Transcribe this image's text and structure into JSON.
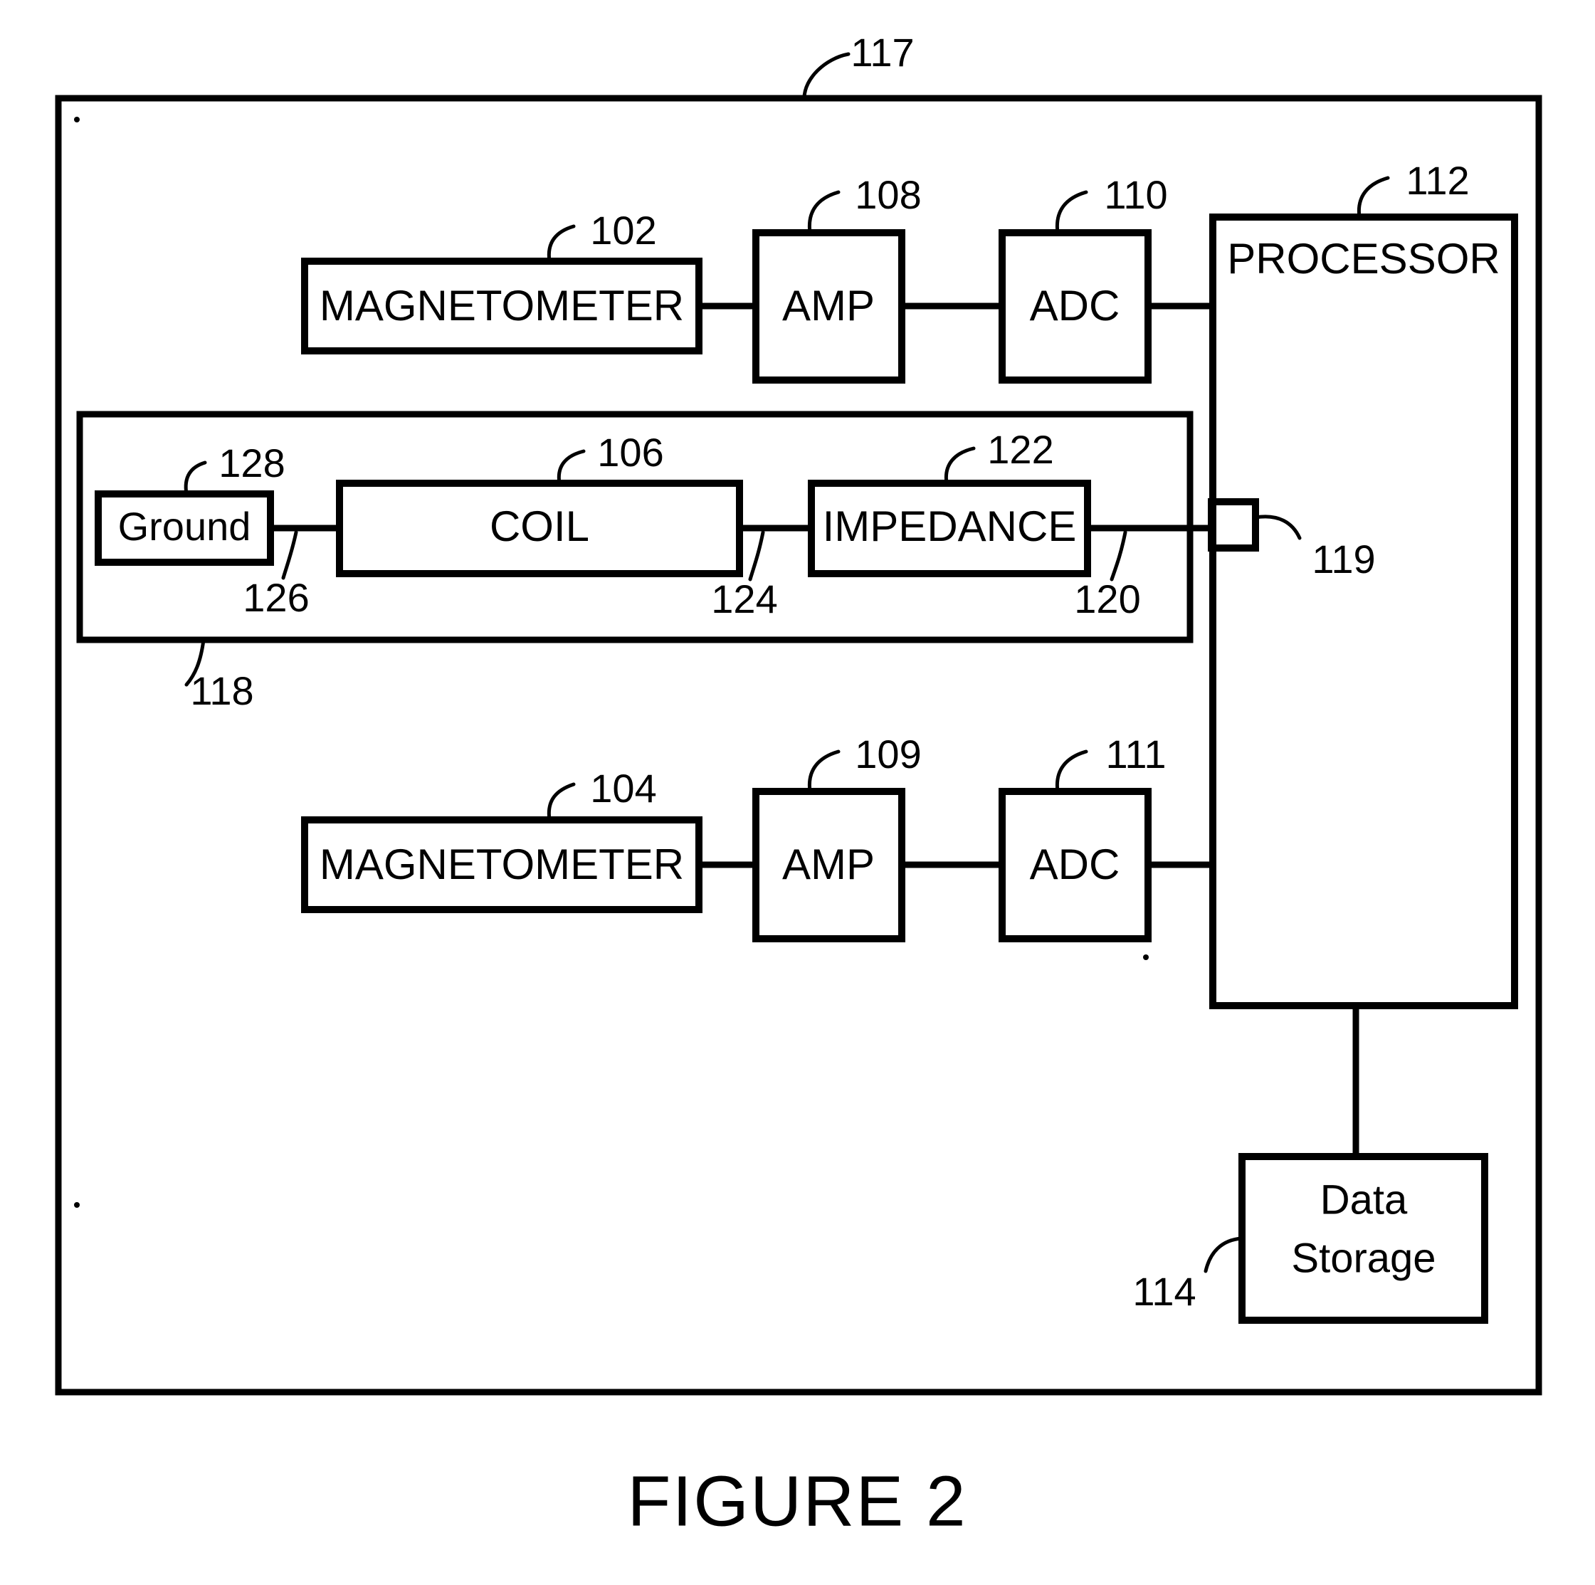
{
  "figure": {
    "caption": "FIGURE 2",
    "outer_ref": "117"
  },
  "blocks": {
    "magnetometer_top": {
      "label": "MAGNETOMETER",
      "ref": "102"
    },
    "amp_top": {
      "label": "AMP",
      "ref": "108"
    },
    "adc_top": {
      "label": "ADC",
      "ref": "110"
    },
    "processor": {
      "label": "PROCESSOR",
      "ref": "112"
    },
    "ground": {
      "label": "Ground",
      "ref": "128"
    },
    "coil": {
      "label": "COIL",
      "ref": "106"
    },
    "impedance": {
      "label": "IMPEDANCE",
      "ref": "122"
    },
    "magnetometer_bottom": {
      "label": "MAGNETOMETER",
      "ref": "104"
    },
    "amp_bottom": {
      "label": "AMP",
      "ref": "109"
    },
    "adc_bottom": {
      "label": "ADC",
      "ref": "111"
    },
    "data_storage": {
      "label_line1": "Data",
      "label_line2": "Storage",
      "ref": "114"
    }
  },
  "refs": {
    "sensor_group": "118",
    "connector": "119",
    "lead_impedance_to_processor": "120",
    "lead_coil_to_impedance": "124",
    "lead_ground_to_coil": "126"
  },
  "colors": {
    "ink": "#000000",
    "paper": "#ffffff"
  }
}
